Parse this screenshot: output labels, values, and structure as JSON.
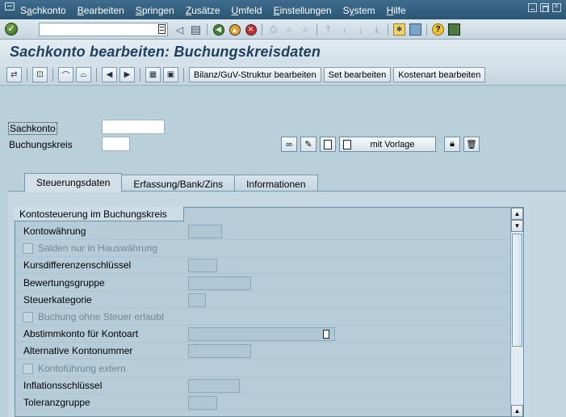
{
  "menu": {
    "items": [
      {
        "label": "Sachkonto",
        "u": "a"
      },
      {
        "label": "Bearbeiten",
        "u": "B"
      },
      {
        "label": "Springen",
        "u": "S"
      },
      {
        "label": "Zusätze",
        "u": "Z"
      },
      {
        "label": "Umfeld",
        "u": "U"
      },
      {
        "label": "Einstellungen",
        "u": "E"
      },
      {
        "label": "System",
        "u": "y"
      },
      {
        "label": "Hilfe",
        "u": "H"
      }
    ]
  },
  "command_field": {
    "value": "",
    "placeholder": ""
  },
  "title": "Sachkonto bearbeiten: Buchungskreisdaten",
  "app_toolbar": {
    "bilanz_label": "Bilanz/GuV-Struktur bearbeiten",
    "set_label": "Set bearbeiten",
    "kostenart_label": "Kostenart bearbeiten"
  },
  "header": {
    "sachkonto_label": "Sachkonto",
    "sachkonto_value": "",
    "bukrs_label": "Buchungskreis",
    "bukrs_value": "",
    "mit_vorlage_label": "mit Vorlage"
  },
  "tabs": [
    {
      "label": "Steuerungsdaten",
      "active": true
    },
    {
      "label": "Erfassung/Bank/Zins",
      "active": false
    },
    {
      "label": "Informationen",
      "active": false
    }
  ],
  "group": {
    "title": "Kontosteuerung im Buchungskreis",
    "rows": [
      {
        "label": "Kontowährung",
        "type": "field"
      },
      {
        "label": "Salden nur in Hauswährung",
        "type": "checkbox",
        "checked": false
      },
      {
        "label": "Kursdifferenzenschlüssel",
        "type": "field"
      },
      {
        "label": "Bewertungsgruppe",
        "type": "field"
      },
      {
        "label": "Steuerkategorie",
        "type": "field"
      },
      {
        "label": "Buchung ohne Steuer erlaubt",
        "type": "checkbox",
        "checked": false
      },
      {
        "label": "Abstimmkonto für Kontoart",
        "type": "dropdown"
      },
      {
        "label": "Alternative Kontonummer",
        "type": "field"
      },
      {
        "label": "Kontoführung extern",
        "type": "checkbox",
        "checked": false
      },
      {
        "label": "Inflationsschlüssel",
        "type": "field"
      },
      {
        "label": "Toleranzgruppe",
        "type": "field"
      }
    ]
  },
  "icons": {
    "ok": "enter-icon",
    "save": "save-icon",
    "back": "back-icon",
    "exit": "exit-icon",
    "cancel": "cancel-icon",
    "print": "print-icon",
    "find": "find-icon",
    "help": "help-icon"
  }
}
